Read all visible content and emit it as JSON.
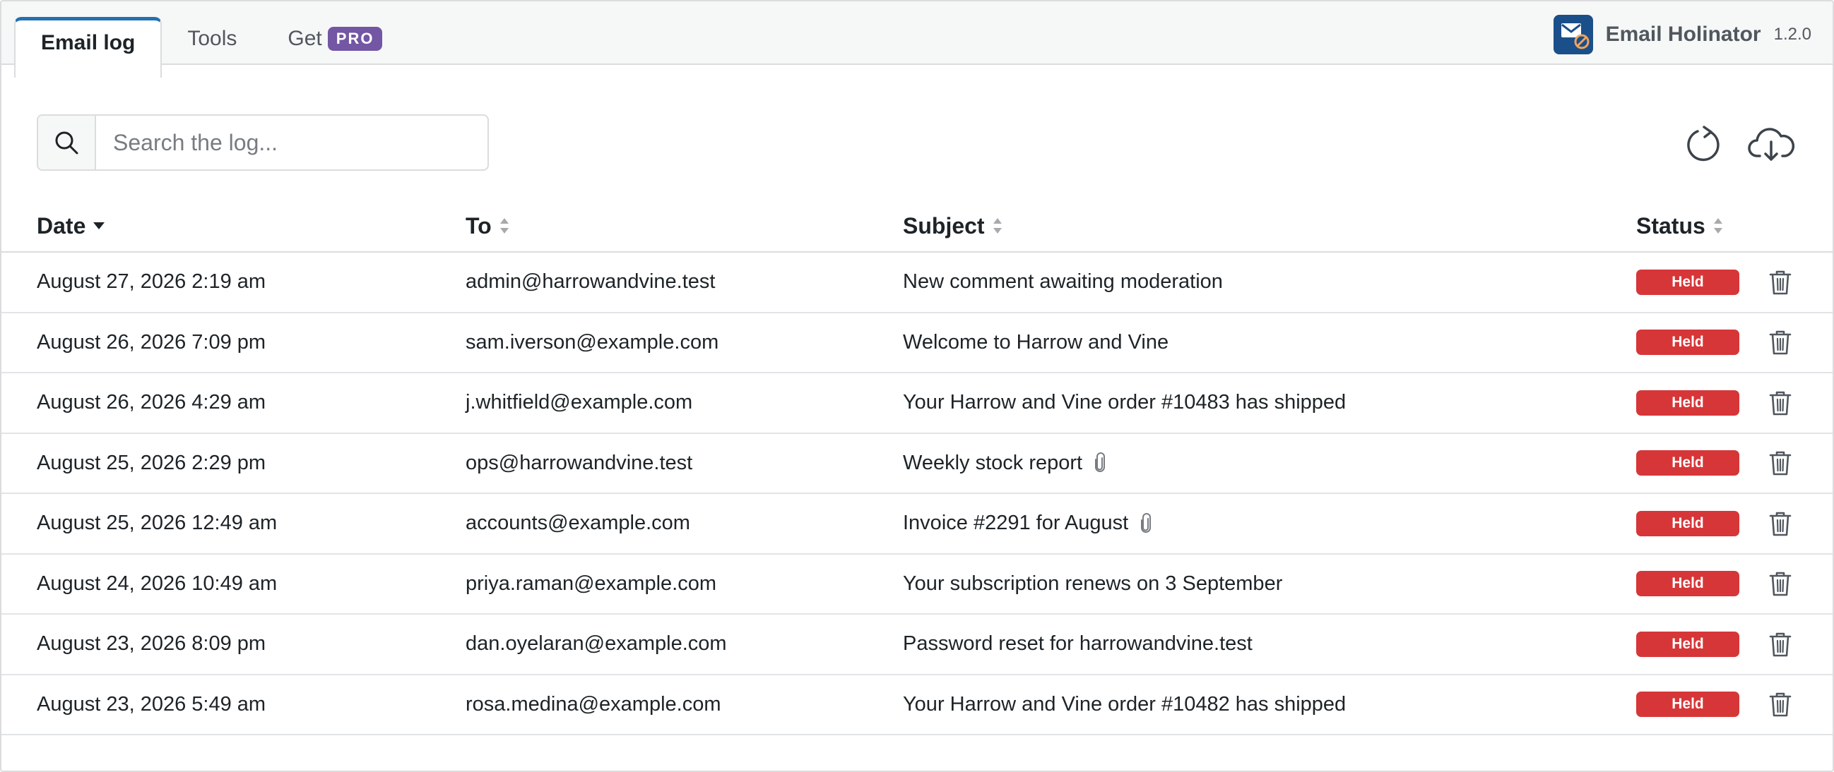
{
  "tabs": [
    {
      "label": "Email log",
      "active": true
    },
    {
      "label": "Tools",
      "active": false
    },
    {
      "label": "Get",
      "badge": "PRO",
      "active": false
    }
  ],
  "brand": {
    "name": "Email Holinator",
    "version": "1.2.0",
    "logo_icon": "envelope-blocked-icon"
  },
  "search": {
    "placeholder": "Search the log...",
    "value": ""
  },
  "toolbar": {
    "refresh_icon": "refresh-icon",
    "download_icon": "cloud-download-icon"
  },
  "table": {
    "columns": [
      {
        "label": "Date",
        "sort": "desc"
      },
      {
        "label": "To",
        "sort": "none"
      },
      {
        "label": "Subject",
        "sort": "none"
      },
      {
        "label": "Status",
        "sort": "none"
      }
    ],
    "rows": [
      {
        "date": "August 27, 2026 2:19 am",
        "to": "admin@harrowandvine.test",
        "subject": "New comment awaiting moderation",
        "attachment": false,
        "status": "Held"
      },
      {
        "date": "August 26, 2026 7:09 pm",
        "to": "sam.iverson@example.com",
        "subject": "Welcome to Harrow and Vine",
        "attachment": false,
        "status": "Held"
      },
      {
        "date": "August 26, 2026 4:29 am",
        "to": "j.whitfield@example.com",
        "subject": "Your Harrow and Vine order #10483 has shipped",
        "attachment": false,
        "status": "Held"
      },
      {
        "date": "August 25, 2026 2:29 pm",
        "to": "ops@harrowandvine.test",
        "subject": "Weekly stock report",
        "attachment": true,
        "status": "Held"
      },
      {
        "date": "August 25, 2026 12:49 am",
        "to": "accounts@example.com",
        "subject": "Invoice #2291 for August",
        "attachment": true,
        "status": "Held"
      },
      {
        "date": "August 24, 2026 10:49 am",
        "to": "priya.raman@example.com",
        "subject": "Your subscription renews on 3 September",
        "attachment": false,
        "status": "Held"
      },
      {
        "date": "August 23, 2026 8:09 pm",
        "to": "dan.oyelaran@example.com",
        "subject": "Password reset for harrowandvine.test",
        "attachment": false,
        "status": "Held"
      },
      {
        "date": "August 23, 2026 5:49 am",
        "to": "rosa.medina@example.com",
        "subject": "Your Harrow and Vine order #10482 has shipped",
        "attachment": false,
        "status": "Held"
      }
    ]
  },
  "colors": {
    "accent": "#2271b1",
    "held": "#d63638",
    "pro": "#7356a4",
    "logo": "#1b4f8a"
  }
}
